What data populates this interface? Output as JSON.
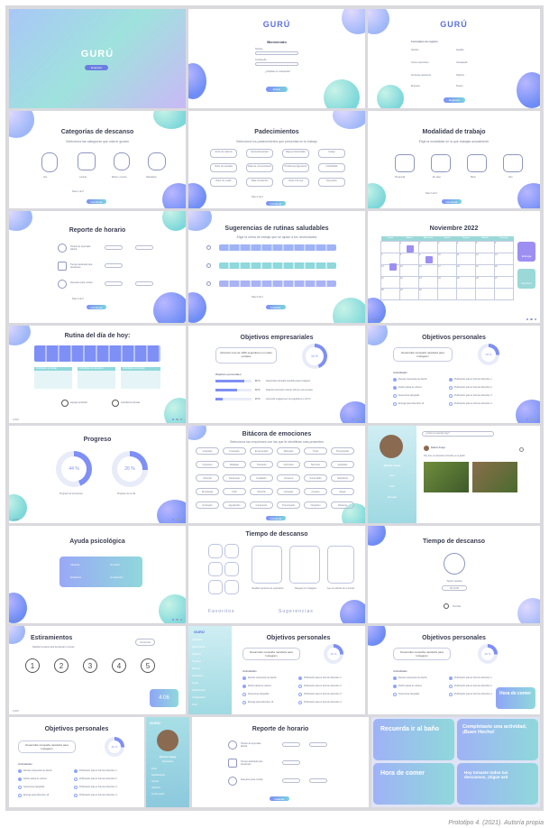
{
  "brand": "GURÚ",
  "caption": "Prototipo 4. (2021). Autoría propia",
  "s1": {
    "logo": "GURÚ",
    "button": "Empezar"
  },
  "s2": {
    "logo": "GURÚ",
    "title": "Bienvenido",
    "fields": [
      "Nombre",
      "Contraseña"
    ],
    "link": "¿Olvidaste tu contraseña?",
    "button": "Entrar"
  },
  "s3": {
    "logo": "GURÚ",
    "title": "Formulario de registro",
    "fields": [
      "Nombre",
      "Apellido",
      "Correo electrónico",
      "Contraseña",
      "Fecha de nacimiento",
      "Teléfono",
      "Empresa",
      "Puesto"
    ],
    "button": "Registrar"
  },
  "s4": {
    "title": "Categorías de descanso",
    "subtitle": "Selecciona las categorías que más te gustan",
    "items": [
      "Arte",
      "Lectura",
      "Mente y cuerpo",
      "Naturaleza"
    ],
    "pager": "Paso 1 de 5",
    "button": "Continuar"
  },
  "s5": {
    "title": "Padecimientos",
    "subtitle": "Selecciona los padecimientos que presentas en tu trabajo",
    "items": [
      "Dolor de cabeza",
      "Estrés/Ansiedad",
      "Baja productividad",
      "Fatiga",
      "Dolor de espalda",
      "Falta de concentración",
      "Problemas digestivos",
      "Irritabilidad",
      "Dolor de cuello",
      "Mala circulación",
      "Visión borrosa",
      "Depresión"
    ],
    "pager": "Paso 2 de 5",
    "button": "Continuar"
  },
  "s6": {
    "title": "Modalidad de trabajo",
    "subtitle": "Elige la modalidad en la que trabajas actualmente",
    "items": [
      "Presencial",
      "En casa",
      "Mixto",
      "Otro"
    ],
    "pager": "Paso 3 de 5",
    "button": "Continuar"
  },
  "s7": {
    "title": "Reporte de horario",
    "rows": [
      "Horario de la jornada laboral",
      "Tiempo destinado para descansos",
      "Descanso para comida"
    ],
    "pager": "Paso 4 de 5",
    "button": "Continuar"
  },
  "s8": {
    "title": "Sugerencias de rutinas saludables",
    "subtitle": "Elige la rutina de trabajo que se ajuste a tus necesidades",
    "pager": "Paso 5 de 5",
    "button": "Finalizar"
  },
  "s9": {
    "title": "Noviembre 2022",
    "days": [
      "Lunes",
      "Martes",
      "Miércoles",
      "Jueves",
      "Viernes",
      "Sábado",
      "Domingo"
    ],
    "cells": [
      "",
      "1",
      "2",
      "3",
      "4",
      "5",
      "6",
      "7",
      "8",
      "9",
      "10",
      "11",
      "12",
      "13",
      "14",
      "15",
      "16",
      "17",
      "18",
      "19",
      "20",
      "21",
      "22",
      "23",
      "24",
      "25",
      "26",
      "27",
      "28",
      "29",
      "30"
    ],
    "btn1": "Entrega",
    "btn2": "Reunión"
  },
  "s10": {
    "title": "Rutina del día de hoy:",
    "col1": "Actividades de trabajo",
    "col2": "Actividades de descanso",
    "col3": "Actividades personales",
    "add": "Agregar actividad",
    "done": "Actividad terminada"
  },
  "s11": {
    "title": "Objetivos empresariales",
    "goal": "Alcanzar mas de 100k seguidores en redes sociales",
    "pct": "44 %",
    "sub": "Objetivos personales:",
    "bars": [
      {
        "p": "80 %",
        "t": "Desarrollar campaña navideña para Instagram"
      },
      {
        "p": "60 %",
        "t": "Realizar promoción viral de 100 por una semana"
      },
      {
        "p": "20 %",
        "t": "Aumentar engagement de seguidores en 20 %"
      }
    ]
  },
  "s12": {
    "title": "Objetivos personales",
    "goal": "Desarrollar campaña navideña para Instagram",
    "pct": "26 %",
    "sub": "Actividades",
    "items": [
      "Revisar propuestas de diseño",
      "Publicación para el fotel de diciembre 1",
      "Definir paleta de colores",
      "Publicación para el fotel de diciembre 2",
      "Seleccionar tipografía",
      "Publicación para el fotel de diciembre 3",
      "Entrega para diciembre 10",
      "Publicación para el fotel de diciembre 4"
    ]
  },
  "s13": {
    "title": "Progreso",
    "a": "44 %",
    "b": "26 %",
    "la": "Progreso de la empresa",
    "lb": "Progreso de mi día"
  },
  "s14": {
    "title": "Bitácora de emociones",
    "subtitle": "Selecciona las emociones con las que te identificas más presentes",
    "items": [
      "Inspirado",
      "Frustrado",
      "Emocionado",
      "Motivado",
      "Triste",
      "Preocupado",
      "Orgulloso",
      "Relajado",
      "Tranquilo",
      "Optimista",
      "Nervioso",
      "Agobiado",
      "Aburrido",
      "Estresado",
      "Enfadado",
      "Contento",
      "Confundido",
      "Satisfecho",
      "Entusiasta",
      "Feliz",
      "Aburrido",
      "Cansado",
      "Ansioso",
      "Alegre",
      "Enfocado",
      "Agradecido",
      "Impaciente",
      "Preocupado",
      "Orgulloso",
      "Paciente"
    ],
    "button": "Continuar"
  },
  "s15": {
    "search": "¿Cómo te sientes hoy?",
    "name": "Beatriz Anaya",
    "menu": [
      "Inicio",
      "Perfil",
      "Mensajes"
    ],
    "post_user": "Beatriz Anaya",
    "post_text": "Hoy tuve un descanso increíble en el jardín"
  },
  "s16": {
    "title": "Ayuda psicológica",
    "b1": "Llámanos",
    "b2": "Ver doctor",
    "b3": "Escríbenos",
    "b4": "Ver directorio"
  },
  "s17": {
    "title": "Tiempo de descanso",
    "sec1": "Favoritos",
    "sec2": "Sugerencias",
    "tile1": "Realizar ejercicios de respiración",
    "tile2": "Navegar por Instagram",
    "tile3": "Leer un artículo de tu interés"
  },
  "s18": {
    "title": "Tiempo de descanso",
    "label": "Tiempo restante",
    "time": "00:10:00",
    "stop": "Terminar"
  },
  "s19": {
    "title": "Estiramientos",
    "subtitle": "Realiza los pasos para descansar tu cuerpo",
    "btn": "Comenzar",
    "nums": [
      "1",
      "2",
      "3",
      "4",
      "5"
    ],
    "timer": "4:06"
  },
  "s20": {
    "logo": "GURÚ",
    "menu": [
      "Calendario",
      "Rutina del día",
      "Objetivos",
      "Progreso",
      "Bitácora",
      "Descansos",
      "Ayuda",
      "Estiramientos",
      "Configuración",
      "Perfil"
    ],
    "title": "Objetivos personales",
    "goal": "Desarrollar campaña navideña para Instagram",
    "pct": "26 %",
    "sub": "Actividades"
  },
  "s21": {
    "title": "Objetivos personales",
    "goal": "Desarrollar campaña navideña para Instagram",
    "pct": "26 %",
    "sub": "Actividades",
    "toast": "Hora de comer"
  },
  "s22": {
    "title": "Objetivos personales",
    "goal": "Desarrollar campaña navideña para Instagram",
    "pct": "26 %",
    "sub": "Actividades"
  },
  "s23": {
    "logo": "GURÚ",
    "name": "Beatriz Anaya",
    "role": "Diseñadora",
    "menu": [
      "Perfil",
      "Notificaciones",
      "Cuenta",
      "Objetivos",
      "Cerrar sesión"
    ]
  },
  "s24": {
    "title": "Reporte de horario",
    "rows": [
      "Horario de la jornada laboral",
      "Tiempo destinado para descansos",
      "Descanso para comida"
    ],
    "button": "Guardar"
  },
  "notif": [
    {
      "t": "Recuerda ir al baño"
    },
    {
      "t": "Completaste una actividad, ¡Buen Hecho!"
    },
    {
      "t": "Hora de comer"
    },
    {
      "t": "Hoy tomaste todos tus descansos, ¡Sigue así!"
    }
  ],
  "colors": {
    "accent": "#7e8ff5",
    "teal": "#7ad2dd"
  }
}
